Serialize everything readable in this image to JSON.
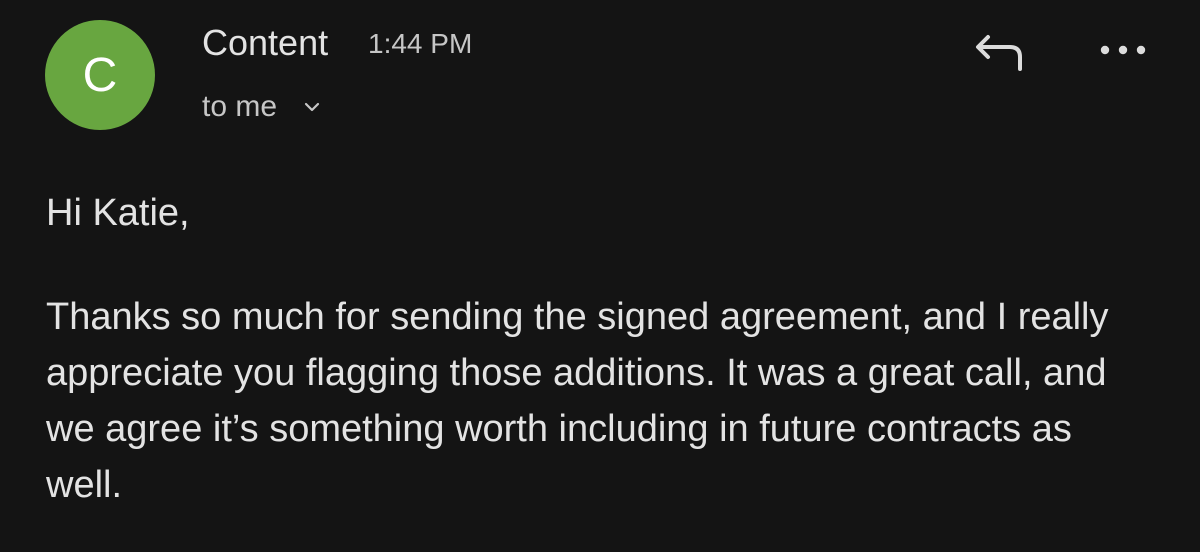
{
  "email": {
    "avatar_letter": "C",
    "avatar_color": "#68a640",
    "sender": "Content",
    "time": "1:44 PM",
    "recipient": "to me"
  },
  "icons": {
    "expand": "chevron-down-icon",
    "reply": "reply-icon",
    "more": "more-horizontal-icon"
  },
  "body": {
    "greeting": "Hi Katie,",
    "paragraph": "Thanks so much for sending the signed agreement, and I really appreciate you flagging those additions. It was a great call, and we agree it’s something worth including in future contracts as well."
  }
}
